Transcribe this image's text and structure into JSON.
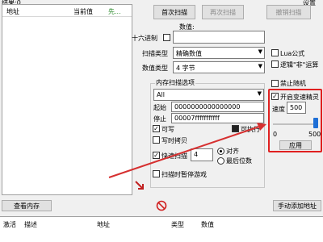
{
  "top_left_text": "结果:0",
  "settings_label": "设置",
  "results_table": {
    "col_address": "地址",
    "col_current": "当前值",
    "col_previous": "先..."
  },
  "buttons": {
    "first_scan": "首次扫描",
    "next_scan": "再次扫描",
    "undo_scan": "撤销扫描",
    "view_memory": "查看内存",
    "add_address_manually": "手动添加地址",
    "apply": "应用"
  },
  "scan": {
    "value_label": "数值:",
    "hex_label": "十六进制",
    "scan_type_label": "扫描类型",
    "scan_type_value": "精确数值",
    "value_type_label": "数值类型",
    "value_type_value": "4 字节",
    "memory_options_title": "内存扫描选项",
    "region_value": "All",
    "start_label": "起始",
    "start_value": "0000000000000000",
    "stop_label": "停止",
    "stop_value": "00007fffffffffff",
    "writable_label": "可写",
    "executable_label": "可执行",
    "copy_on_write_label": "写时拷贝",
    "fast_scan_label": "快速扫描",
    "fast_scan_value": "4",
    "align_label": "对齐",
    "last_digit_label": "最后位数",
    "pause_game_label": "扫描时暂停游戏"
  },
  "options": {
    "lua_label": "Lua公式",
    "not_logic_label": "逻辑\"非\"运算",
    "disable_random_label": "禁止随机",
    "speedhack_label": "开启变速精灵",
    "speed_label": "速度",
    "speed_value": "500",
    "slider_min": "0",
    "slider_max": "500",
    "slider_fraction": 1.0
  },
  "address_list": {
    "col_active": "激活",
    "col_description": "描述",
    "col_address": "地址",
    "col_type": "类型",
    "col_value": "数值"
  },
  "colors": {
    "highlight_box": "#e02020",
    "arrow": "#d63030",
    "previous_col_text": "#2e8b2e",
    "slider_thumb": "#1e6fd6"
  }
}
